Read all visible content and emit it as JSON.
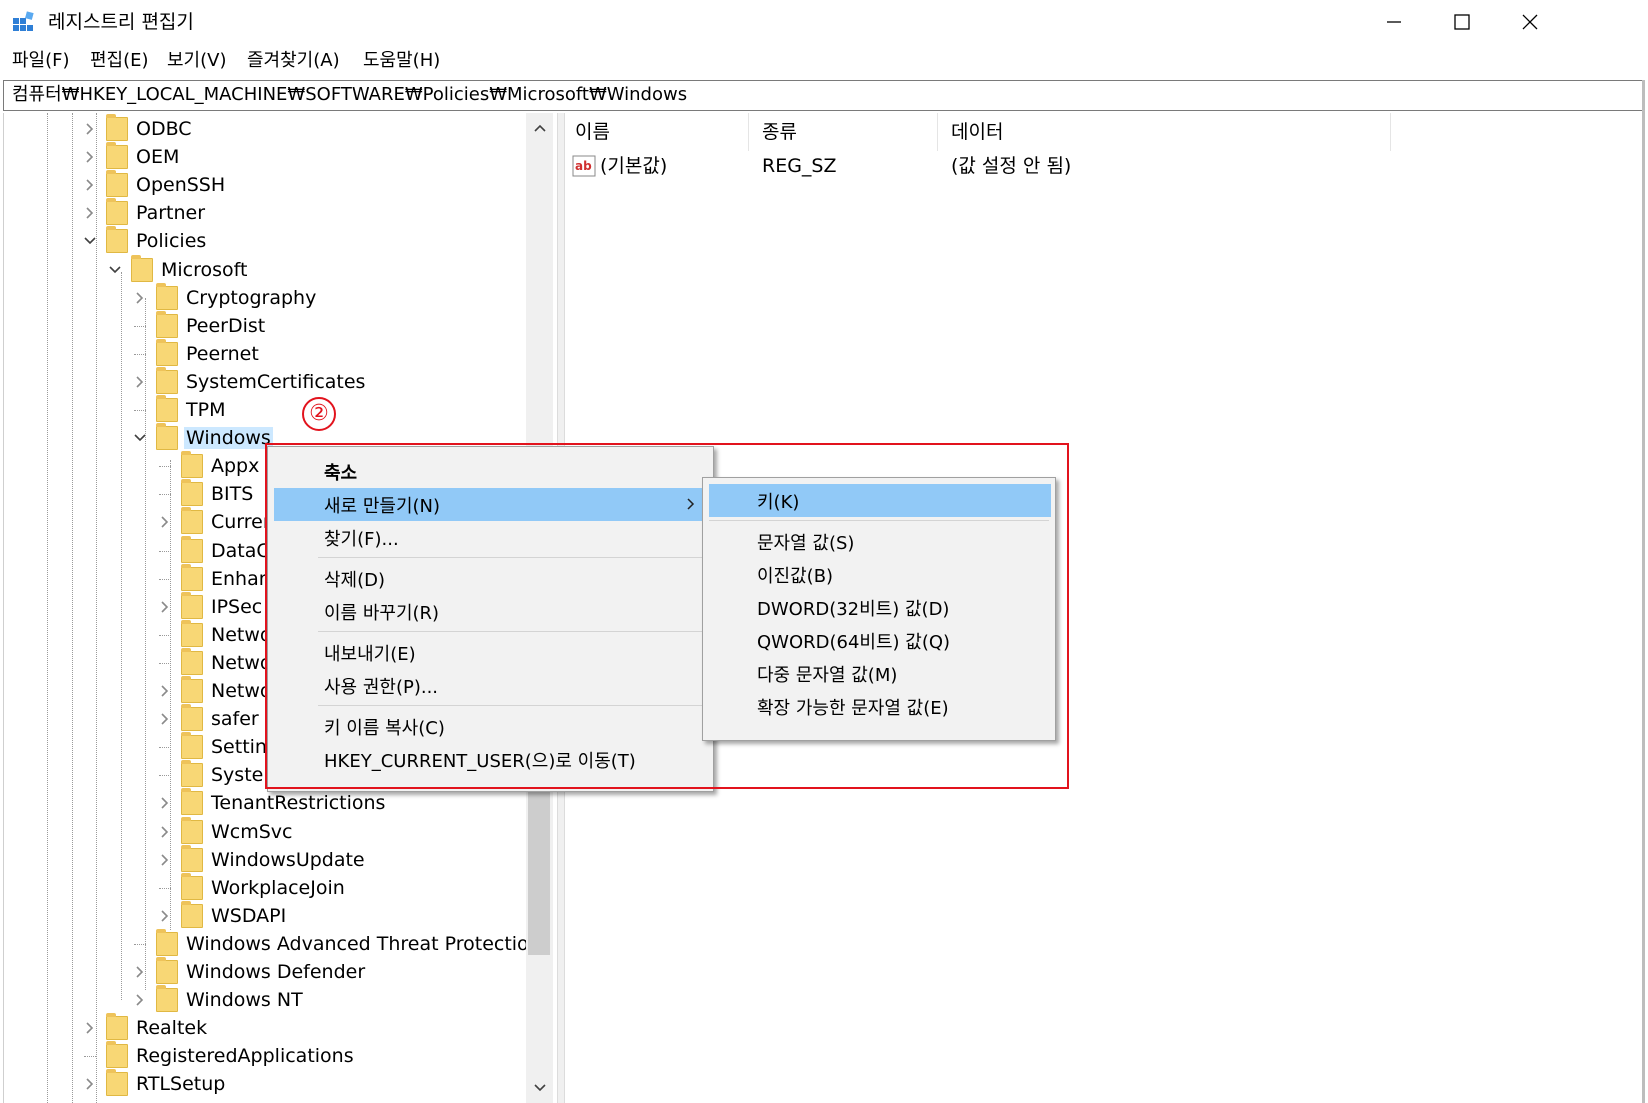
{
  "window": {
    "title": "레지스트리 편집기",
    "controls": {
      "minimize_icon": "minimize-icon",
      "maximize_icon": "maximize-icon",
      "close_icon": "close-icon"
    }
  },
  "menubar": [
    "파일(F)",
    "편집(E)",
    "보기(V)",
    "즐겨찾기(A)",
    "도움말(H)"
  ],
  "address": "컴퓨터₩HKEY_LOCAL_MACHINE₩SOFTWARE₩Policies₩Microsoft₩Windows",
  "tree": [
    {
      "label": "ODBC",
      "expander": "collapsed"
    },
    {
      "label": "OEM",
      "expander": "collapsed"
    },
    {
      "label": "OpenSSH",
      "expander": "collapsed"
    },
    {
      "label": "Partner",
      "expander": "collapsed"
    },
    {
      "label": "Policies",
      "expander": "expanded"
    },
    {
      "label": "Microsoft",
      "expander": "expanded"
    },
    {
      "label": "Cryptography",
      "expander": "collapsed"
    },
    {
      "label": "PeerDist",
      "expander": "none"
    },
    {
      "label": "Peernet",
      "expander": "none"
    },
    {
      "label": "SystemCertificates",
      "expander": "collapsed"
    },
    {
      "label": "TPM",
      "expander": "none"
    },
    {
      "label": "Windows",
      "expander": "expanded",
      "selected": true
    },
    {
      "label": "Appx",
      "expander": "none"
    },
    {
      "label": "BITS",
      "expander": "none"
    },
    {
      "label": "Curren",
      "expander": "collapsed"
    },
    {
      "label": "DataC",
      "expander": "none"
    },
    {
      "label": "Enhan",
      "expander": "none"
    },
    {
      "label": "IPSec",
      "expander": "collapsed"
    },
    {
      "label": "Netwo",
      "expander": "none"
    },
    {
      "label": "Netwo",
      "expander": "none"
    },
    {
      "label": "Netwo",
      "expander": "collapsed"
    },
    {
      "label": "safer",
      "expander": "collapsed"
    },
    {
      "label": "Settin",
      "expander": "none"
    },
    {
      "label": "Syster",
      "expander": "none"
    },
    {
      "label": "TenantRestrictions",
      "expander": "collapsed"
    },
    {
      "label": "WcmSvc",
      "expander": "collapsed"
    },
    {
      "label": "WindowsUpdate",
      "expander": "collapsed"
    },
    {
      "label": "WorkplaceJoin",
      "expander": "none"
    },
    {
      "label": "WSDAPI",
      "expander": "collapsed"
    },
    {
      "label": "Windows Advanced Threat Protection",
      "expander": "none"
    },
    {
      "label": "Windows Defender",
      "expander": "collapsed"
    },
    {
      "label": "Windows NT",
      "expander": "collapsed"
    },
    {
      "label": "Realtek",
      "expander": "collapsed"
    },
    {
      "label": "RegisteredApplications",
      "expander": "none"
    },
    {
      "label": "RTLSetup",
      "expander": "collapsed"
    }
  ],
  "list": {
    "headers": [
      "이름",
      "종류",
      "데이터"
    ],
    "rows": [
      {
        "icon": "string-value-icon",
        "name": "(기본값)",
        "type": "REG_SZ",
        "data": "(값 설정 안 됨)"
      }
    ]
  },
  "annotation": {
    "step": "②",
    "color": "#e2131d"
  },
  "context_menu": [
    {
      "label": "축소",
      "bold": true
    },
    {
      "label": "새로 만들기(N)",
      "submenu": true,
      "highlighted": true
    },
    {
      "label": "찾기(F)..."
    },
    {
      "separator": true
    },
    {
      "label": "삭제(D)"
    },
    {
      "label": "이름 바꾸기(R)"
    },
    {
      "separator": true
    },
    {
      "label": "내보내기(E)"
    },
    {
      "label": "사용 권한(P)..."
    },
    {
      "separator": true
    },
    {
      "label": "키 이름 복사(C)"
    },
    {
      "label": "HKEY_CURRENT_USER(으)로 이동(T)"
    }
  ],
  "submenu": [
    {
      "label": "키(K)",
      "highlighted": true
    },
    {
      "separator": true
    },
    {
      "label": "문자열 값(S)"
    },
    {
      "label": "이진값(B)"
    },
    {
      "label": "DWORD(32비트) 값(D)"
    },
    {
      "label": "QWORD(64비트) 값(Q)"
    },
    {
      "label": "다중 문자열 값(M)"
    },
    {
      "label": "확장 가능한 문자열 값(E)"
    }
  ],
  "colors": {
    "highlight": "#91c9f7",
    "selected_tree": "#cce8ff",
    "folder": "#f8d775",
    "annotation_red": "#e2131d"
  }
}
